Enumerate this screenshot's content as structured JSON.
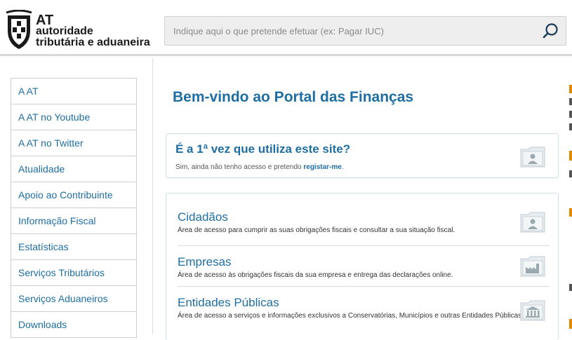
{
  "header": {
    "logo": {
      "line1": "AT",
      "line2": "autoridade",
      "line3": "tributária e aduaneira"
    },
    "search": {
      "placeholder": "Indique aqui o que pretende efetuar (ex: Pagar IUC)",
      "value": ""
    }
  },
  "sidebar": {
    "items": [
      {
        "label": "A AT"
      },
      {
        "label": "A AT no Youtube"
      },
      {
        "label": "A AT no Twitter"
      },
      {
        "label": "Atualidade"
      },
      {
        "label": "Apoio ao Contribuinte"
      },
      {
        "label": "Informação Fiscal"
      },
      {
        "label": "Estatísticas"
      },
      {
        "label": "Serviços Tributários"
      },
      {
        "label": "Serviços Aduaneiros"
      },
      {
        "label": "Downloads"
      }
    ]
  },
  "main": {
    "title": "Bem-vindo ao Portal das Finanças",
    "first_visit": {
      "title": "É a 1ª vez que utiliza este site?",
      "text": "Sim, ainda não tenho acesso e pretendo ",
      "link": "registar-me",
      "suffix": "."
    },
    "services": [
      {
        "name": "Cidadãos",
        "desc": "Área de acesso para cumprir as suas obrigações fiscais e consultar a sua situação fiscal.",
        "icon": "person-folder-icon"
      },
      {
        "name": "Empresas",
        "desc": "Área de acesso às obrigações fiscais da sua empresa e entrega das declarações online.",
        "icon": "factory-folder-icon"
      },
      {
        "name": "Entidades Públicas",
        "desc": "Área de acesso a serviços e informações exclusivos a Conservatórias, Municípios e outras Entidades Públicas.",
        "icon": "building-folder-icon"
      }
    ]
  },
  "colors": {
    "link_blue": "#1f6ea3",
    "accent_orange": "#e08a00"
  }
}
